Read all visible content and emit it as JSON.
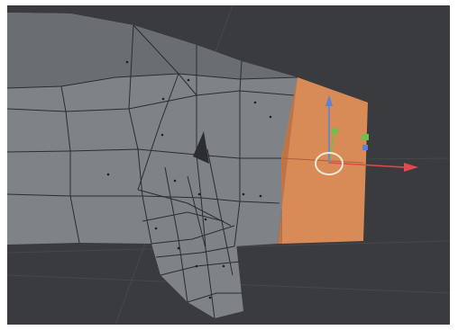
{
  "viewport": {
    "background": "#393b3e",
    "mesh_color": "#7f8387",
    "mesh_shade": "#6a6e72",
    "edge_color": "#2b2d30",
    "selected_face_color": "#d88a57",
    "selected_face_shade": "#c07445"
  },
  "gizmo": {
    "x_axis_color": "#e0494f",
    "y_axis_color": "#6fc04a",
    "z_axis_color": "#5b82d6",
    "pivot_ring_color": "#f4e8d8",
    "icons": [
      "move-gizmo-icon",
      "pivot-ring-icon"
    ]
  }
}
